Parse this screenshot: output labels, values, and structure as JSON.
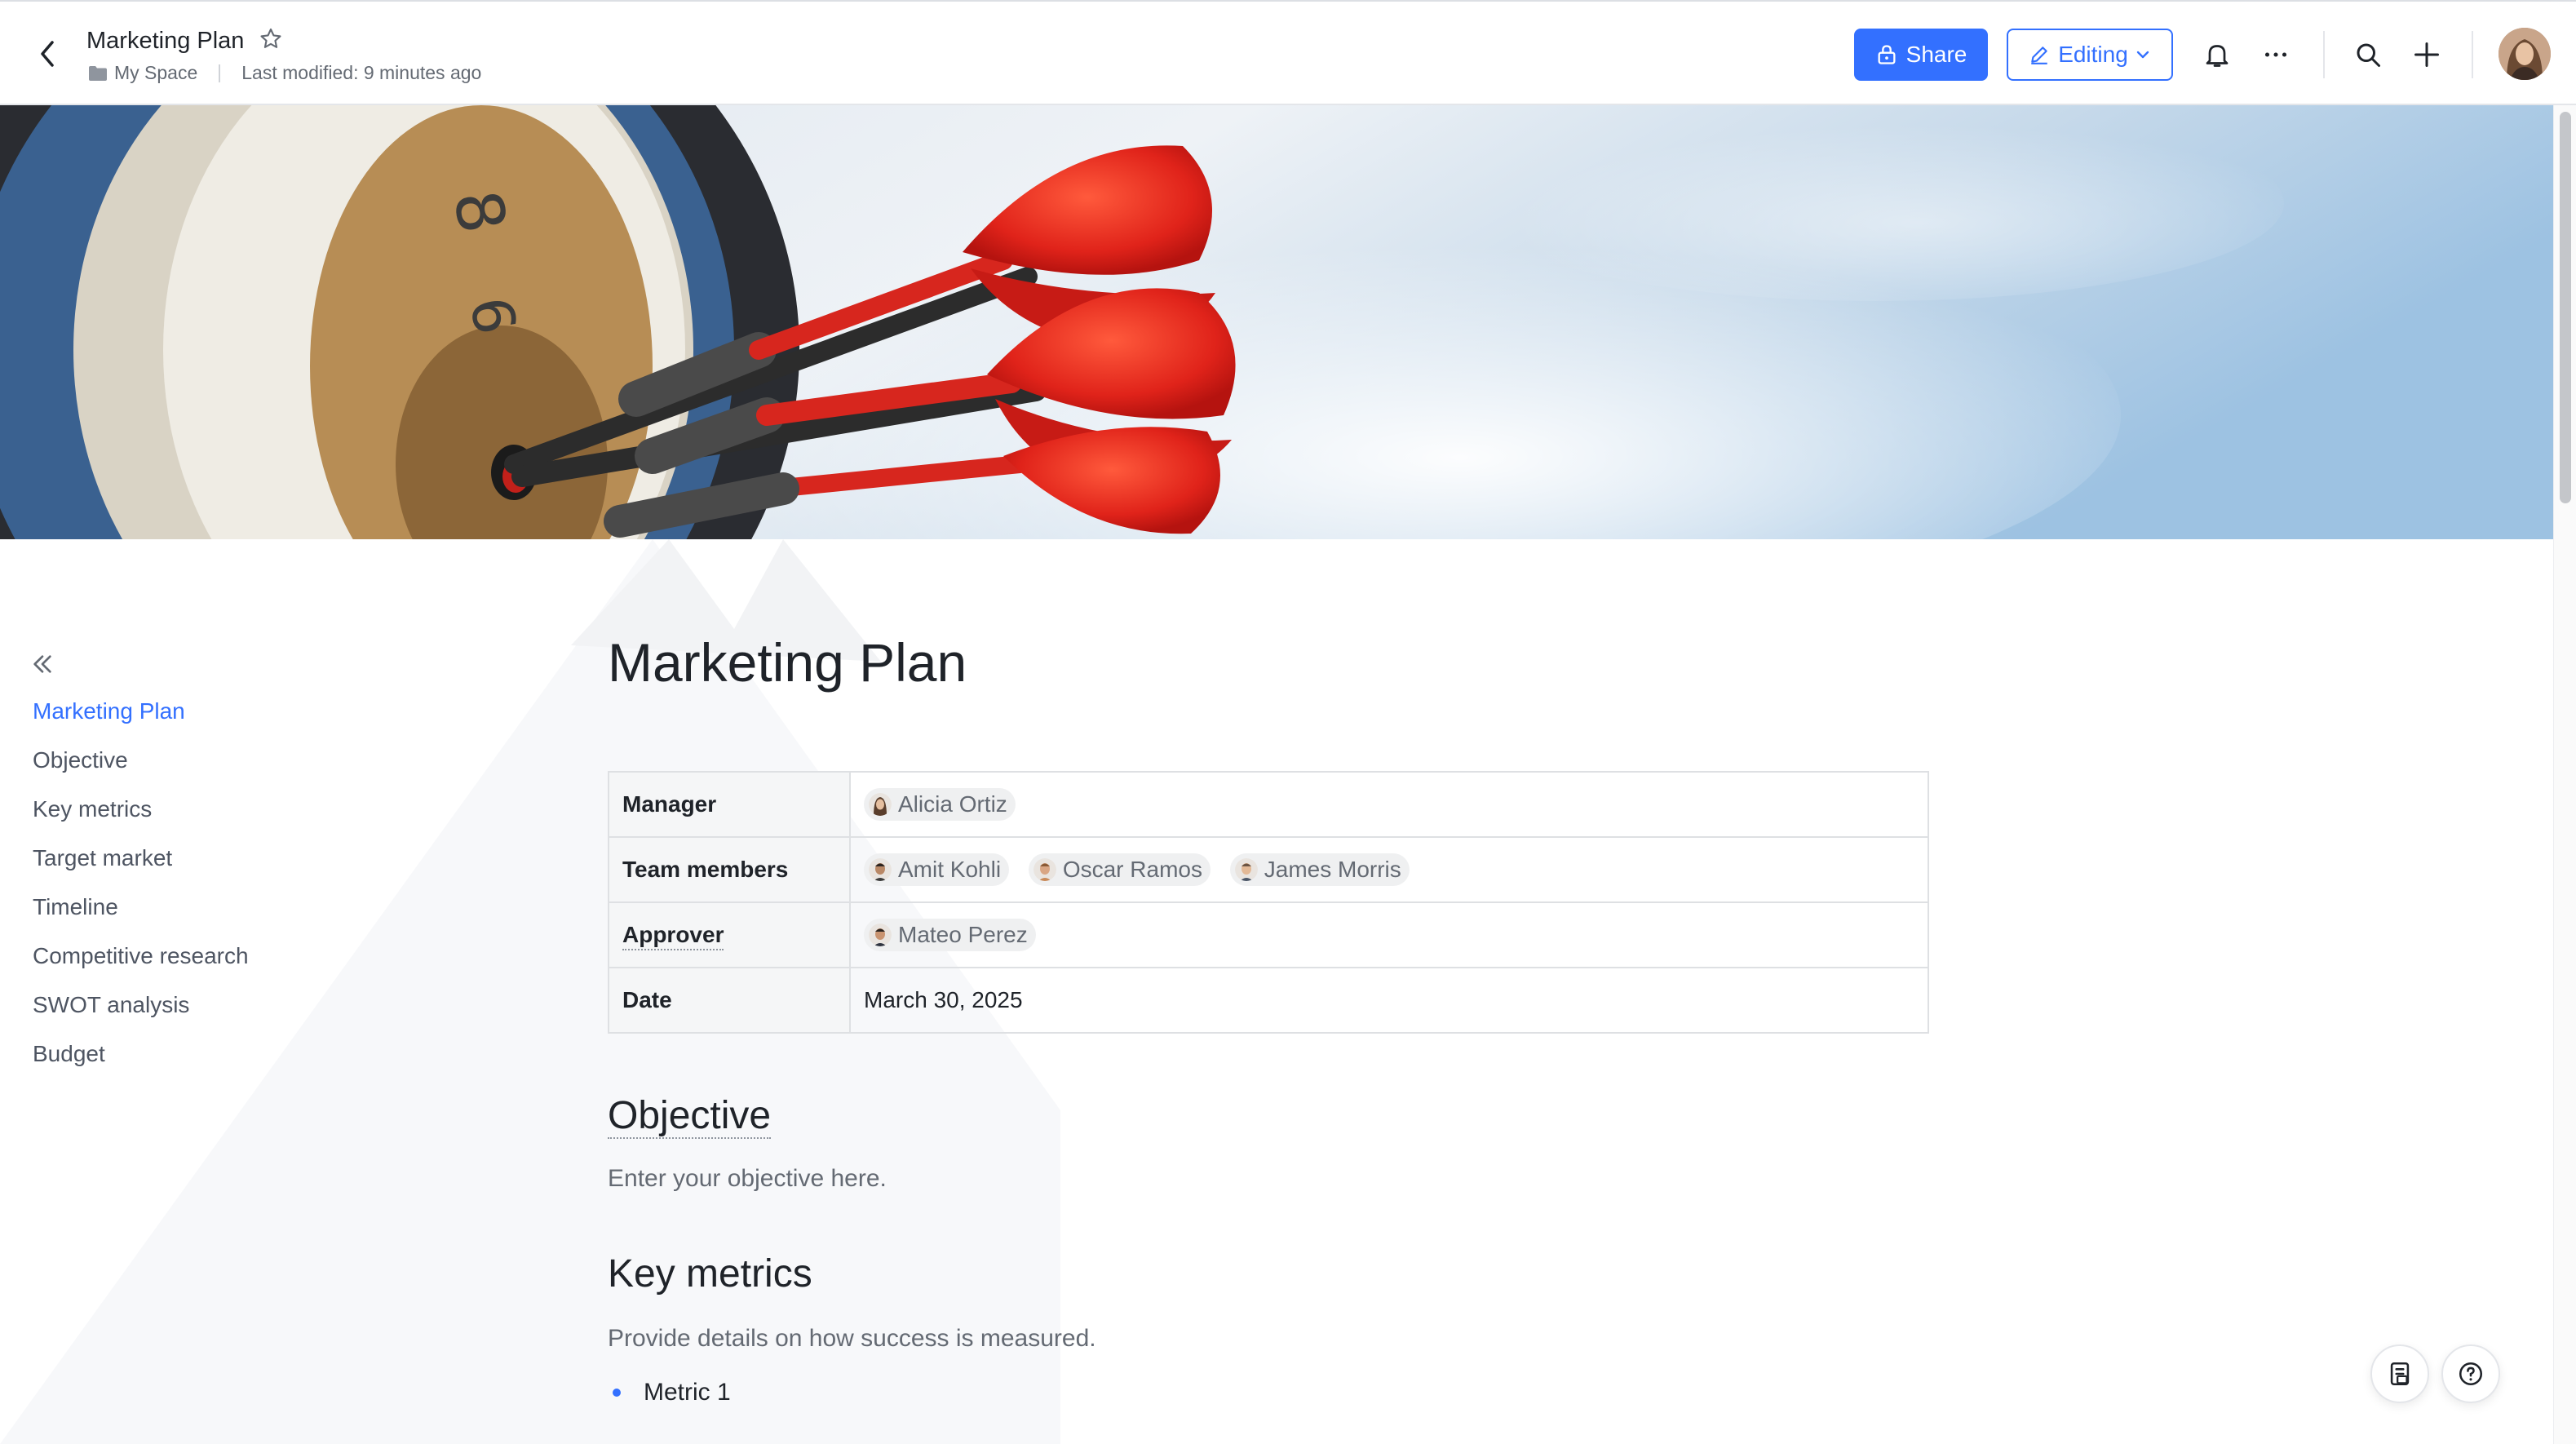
{
  "header": {
    "title": "Marketing Plan",
    "location": "My Space",
    "last_modified": "Last modified: 9 minutes ago",
    "share_label": "Share",
    "editing_label": "Editing"
  },
  "toc": {
    "items": [
      {
        "label": "Marketing Plan",
        "active": true
      },
      {
        "label": "Objective"
      },
      {
        "label": "Key metrics"
      },
      {
        "label": "Target market"
      },
      {
        "label": "Timeline"
      },
      {
        "label": "Competitive research"
      },
      {
        "label": "SWOT analysis"
      },
      {
        "label": "Budget"
      }
    ]
  },
  "doc": {
    "title": "Marketing Plan",
    "table": {
      "manager_label": "Manager",
      "manager": "Alicia Ortiz",
      "team_label": "Team members",
      "team": [
        "Amit Kohli",
        "Oscar Ramos",
        "James Morris"
      ],
      "approver_label": "Approver",
      "approver": "Mateo Perez",
      "date_label": "Date",
      "date": "March 30, 2025"
    },
    "objective_heading": "Objective",
    "objective_text": "Enter your objective here.",
    "metrics_heading": "Key metrics",
    "metrics_text": "Provide details on how success is measured.",
    "metric_1": "Metric 1"
  },
  "colors": {
    "accent": "#3370ff",
    "text_primary": "#1f2329",
    "text_secondary": "#646a73",
    "dart_red": "#e4241b"
  },
  "icons": [
    "back-arrow-icon",
    "star-icon",
    "folder-icon",
    "lock-icon",
    "pen-icon",
    "chevron-down-icon",
    "bell-icon",
    "more-icon",
    "search-icon",
    "plus-icon",
    "collapse-icon",
    "doc-outline-icon",
    "help-icon"
  ]
}
